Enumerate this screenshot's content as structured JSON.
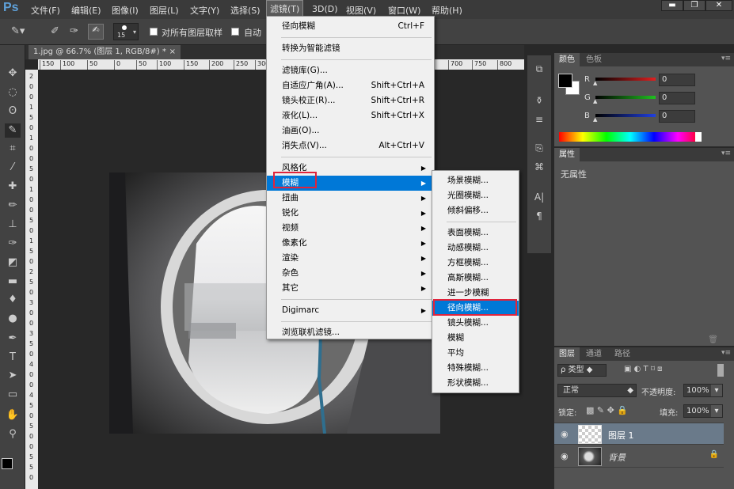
{
  "app": {
    "logo": "Ps"
  },
  "menubar": {
    "items": [
      "文件(F)",
      "编辑(E)",
      "图像(I)",
      "图层(L)",
      "文字(Y)",
      "选择(S)",
      "滤镜(T)",
      "3D(D)",
      "视图(V)",
      "窗口(W)",
      "帮助(H)"
    ],
    "active_index": 6,
    "window_buttons": [
      "▬",
      "❐",
      "✕"
    ]
  },
  "optionsbar": {
    "brush_size": "15",
    "sample_all_layers": "对所有图层取样",
    "auto_label": "自动"
  },
  "document_tab": {
    "title": "1.jpg @ 66.7% (图层 1, RGB/8#) *",
    "close": "×"
  },
  "ruler": {
    "h_ticks": [
      "150",
      "100",
      "50",
      "0",
      "50",
      "100",
      "150",
      "200",
      "250",
      "300",
      "700",
      "750",
      "800"
    ],
    "v_ticks": [
      "2",
      "0",
      "0",
      "1",
      "5",
      "0",
      "1",
      "0",
      "0",
      "5",
      "0",
      "1",
      "0",
      "0",
      "5",
      "0",
      "1",
      "5",
      "0",
      "2",
      "5",
      "0",
      "3",
      "0",
      "0",
      "3",
      "5",
      "0",
      "4",
      "0",
      "0",
      "4",
      "5",
      "0",
      "5",
      "0",
      "0",
      "5",
      "5",
      "0"
    ]
  },
  "filter_menu": {
    "items": [
      {
        "label": "径向模糊",
        "shortcut": "Ctrl+F"
      },
      {
        "sep": true
      },
      {
        "label": "转换为智能滤镜"
      },
      {
        "sep": true
      },
      {
        "label": "滤镜库(G)..."
      },
      {
        "label": "自适应广角(A)...",
        "shortcut": "Shift+Ctrl+A"
      },
      {
        "label": "镜头校正(R)...",
        "shortcut": "Shift+Ctrl+R"
      },
      {
        "label": "液化(L)...",
        "shortcut": "Shift+Ctrl+X"
      },
      {
        "label": "油画(O)..."
      },
      {
        "label": "消失点(V)...",
        "shortcut": "Alt+Ctrl+V"
      },
      {
        "sep": true
      },
      {
        "label": "风格化",
        "sub": true
      },
      {
        "label": "模糊",
        "sub": true,
        "highlight": true
      },
      {
        "label": "扭曲",
        "sub": true
      },
      {
        "label": "锐化",
        "sub": true
      },
      {
        "label": "视频",
        "sub": true
      },
      {
        "label": "像素化",
        "sub": true
      },
      {
        "label": "渲染",
        "sub": true
      },
      {
        "label": "杂色",
        "sub": true
      },
      {
        "label": "其它",
        "sub": true
      },
      {
        "sep": true
      },
      {
        "label": "Digimarc",
        "sub": true
      },
      {
        "sep": true
      },
      {
        "label": "浏览联机滤镜..."
      }
    ]
  },
  "blur_submenu": {
    "items": [
      {
        "label": "场景模糊..."
      },
      {
        "label": "光圈模糊..."
      },
      {
        "label": "倾斜偏移..."
      },
      {
        "sep": true
      },
      {
        "label": "表面模糊..."
      },
      {
        "label": "动感模糊..."
      },
      {
        "label": "方框模糊..."
      },
      {
        "label": "高斯模糊..."
      },
      {
        "label": "进一步模糊"
      },
      {
        "label": "径向模糊...",
        "highlight": true
      },
      {
        "label": "镜头模糊..."
      },
      {
        "label": "模糊"
      },
      {
        "label": "平均"
      },
      {
        "label": "特殊模糊..."
      },
      {
        "label": "形状模糊..."
      }
    ]
  },
  "color_panel": {
    "tabs": [
      "颜色",
      "色板"
    ],
    "channels": [
      {
        "label": "R",
        "value": "0",
        "color": "#e02020"
      },
      {
        "label": "G",
        "value": "0",
        "color": "#20c020"
      },
      {
        "label": "B",
        "value": "0",
        "color": "#2040e0"
      }
    ]
  },
  "properties_panel": {
    "tab": "属性",
    "content": "无属性"
  },
  "layers_panel": {
    "tabs": [
      "图层",
      "通道",
      "路径"
    ],
    "filter_label": "ρ 类型",
    "blend_mode": "正常",
    "opacity_label": "不透明度:",
    "opacity_value": "100%",
    "lock_label": "锁定:",
    "fill_label": "填充:",
    "fill_value": "100%",
    "layers": [
      {
        "name": "图层 1",
        "selected": true
      },
      {
        "name": "背景",
        "locked": true
      }
    ]
  }
}
